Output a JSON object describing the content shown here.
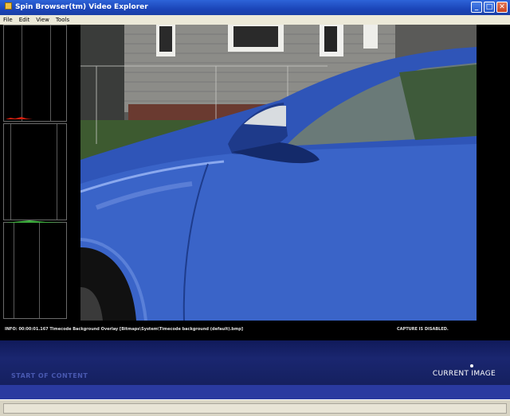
{
  "window": {
    "title": "Spin Browser(tm) Video Explorer"
  },
  "menu": {
    "items": [
      "File",
      "Edit",
      "View",
      "Tools"
    ]
  },
  "info_bar": {
    "info_text": "INFO: 00:00:01.167 Timecode Background Overlay [Bitmaps\\System\\Timecode background (default).bmp]",
    "capture_status": "CAPTURE IS DISABLED."
  },
  "bottom_panel": {
    "start_label": "START OF CONTENT",
    "current_label": "CURRENT IMAGE"
  },
  "histograms": [
    {
      "channel": "red",
      "color": "#d02010"
    },
    {
      "channel": "blue",
      "color": "#3050c0"
    },
    {
      "channel": "green",
      "color": "#30a030"
    }
  ]
}
